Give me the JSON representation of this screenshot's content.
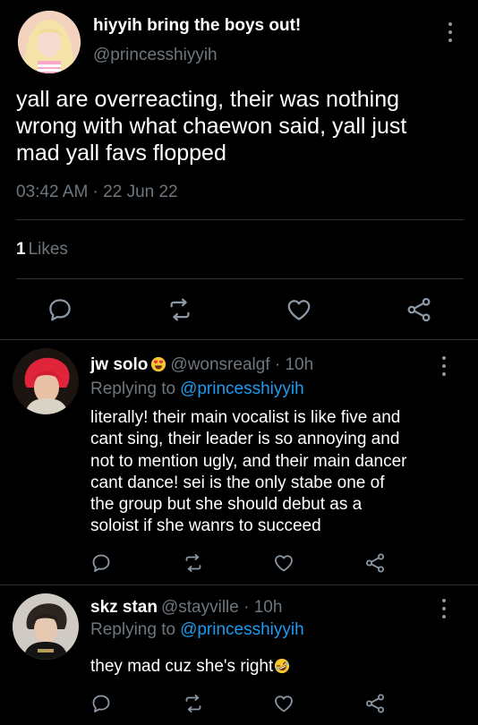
{
  "main_tweet": {
    "display_name": "hiyyih bring the boys out!",
    "handle": "@princesshiyyih",
    "text": "yall are overreacting, their was nothing\nwrong with what chaewon said, yall just\nmad yall favs flopped",
    "timestamp": "03:42 AM · 22 Jun 22",
    "likes_count": "1",
    "likes_label": "Likes",
    "avatar_icon": "user-avatar-pink-hair"
  },
  "replies": [
    {
      "display_name": "jw solo",
      "name_emoji": "heart-eyes-emoji",
      "handle_time": "@wonsrealgf · 10h",
      "replying_label": "Replying to",
      "replying_to": "@princesshiyyih",
      "text": "literally! their main vocalist is like five and\ncant sing, their leader is so annoying and\nnot to mention ugly, and their main dancer\ncant dance! sei is the only stabe one of\nthe group but she should debut as a\nsoloist if she wanrs to succeed",
      "avatar_icon": "user-avatar-red-hair"
    },
    {
      "display_name": "skz stan",
      "handle_time": "@stayville · 10h",
      "replying_label": "Replying to",
      "replying_to": "@princesshiyyih",
      "text": "they mad cuz she's right",
      "text_emoji": "rofl-emoji",
      "avatar_icon": "user-avatar-dark-hair"
    }
  ],
  "colors": {
    "background": "#000000",
    "primary_text": "#ffffff",
    "secondary_text": "#6e767d",
    "divider": "#2f3336",
    "link": "#1d9bf0"
  }
}
